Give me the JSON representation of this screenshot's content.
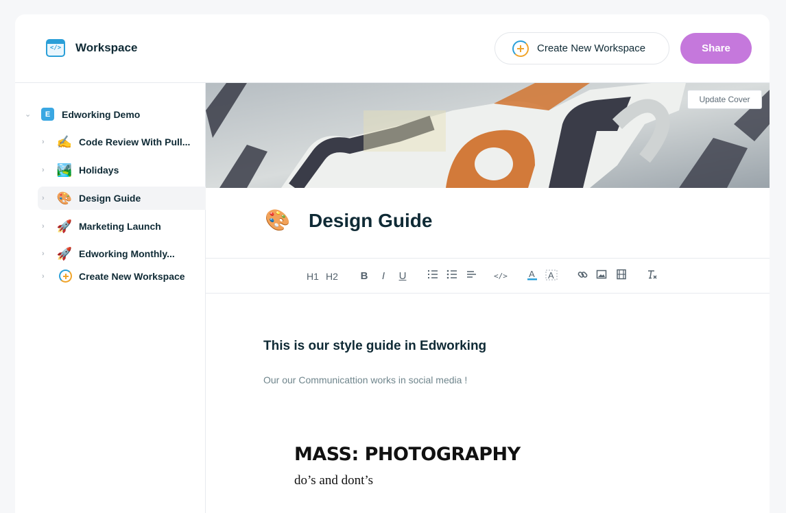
{
  "header": {
    "title": "Workspace",
    "create_label": "Create New Workspace",
    "share_label": "Share",
    "accent_color": "#c578dc"
  },
  "sidebar": {
    "workspace": {
      "badge": "E",
      "label": "Edworking Demo"
    },
    "items": [
      {
        "emoji": "✍️",
        "label": "Code Review With Pull...",
        "active": false
      },
      {
        "emoji": "🏞️",
        "label": "Holidays",
        "active": false
      },
      {
        "emoji": "🎨",
        "label": "Design Guide",
        "active": true
      },
      {
        "emoji": "🚀",
        "label": "Marketing Launch",
        "active": false
      },
      {
        "emoji": "🚀",
        "label": "Edworking Monthly...",
        "active": false
      }
    ],
    "create_label": "Create New Workspace"
  },
  "document": {
    "cover_button": "Update Cover",
    "emoji": "🎨",
    "title": "Design Guide",
    "toolbar": {
      "h1": "H1",
      "h2": "H2",
      "bold": "B",
      "italic": "I",
      "underline": "U",
      "code": "</>"
    },
    "heading": "This is our style guide in Edworking",
    "paragraph": "Our our Communicattion works in social media !",
    "image_title": "MASS: PHOTOGRAPHY",
    "image_subtitle": "do’s and dont’s"
  }
}
